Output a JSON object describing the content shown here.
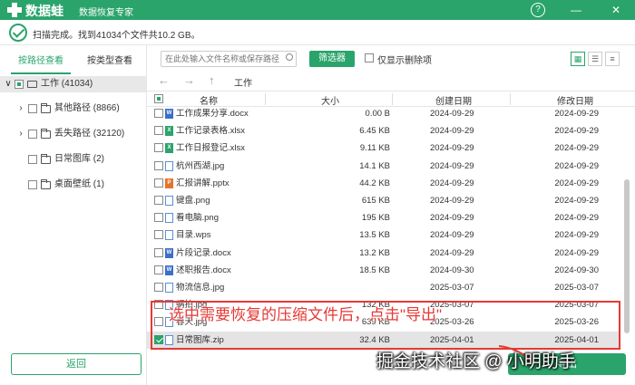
{
  "titlebar": {
    "app_name": "数据蛙",
    "app_subtitle": "数据恢复专家",
    "help_icon": "?",
    "minimize_icon": "—",
    "close_icon": "✕"
  },
  "status": {
    "text": "扫描完成。找到41034个文件共10.2 GB。"
  },
  "sidebar": {
    "tabs": [
      {
        "label": "按路径查看",
        "active": true
      },
      {
        "label": "按类型查看",
        "active": false
      }
    ],
    "tree": [
      {
        "label": "工作 (41034)",
        "expanded": true,
        "check": "partial",
        "icon": "drive-icon",
        "level": 0
      },
      {
        "label": "其他路径 (8866)",
        "expanded": false,
        "check": "none",
        "icon": "folder-icon",
        "level": 1
      },
      {
        "label": "丢失路径 (32120)",
        "expanded": false,
        "check": "none",
        "icon": "folder-icon",
        "level": 1
      },
      {
        "label": "日常图库 (2)",
        "check": "none",
        "icon": "folder-icon",
        "level": 1
      },
      {
        "label": "桌面壁纸 (1)",
        "check": "none",
        "icon": "folder-icon",
        "level": 1
      }
    ],
    "back_label": "返回"
  },
  "toolbar": {
    "search_placeholder": "在此处输入文件名称或保存路径",
    "filter_label": "筛选器",
    "only_deleted_label": "仅显示删除项"
  },
  "path": {
    "current": "工作"
  },
  "table": {
    "headers": {
      "name": "名称",
      "size": "大小",
      "created": "创建日期",
      "modified": "修改日期"
    },
    "rows": [
      {
        "name": "工作成果分享.docx",
        "size": "0.00  B",
        "created": "2024-09-29",
        "modified": "2024-09-29",
        "type": "docx",
        "checked": false
      },
      {
        "name": "工作记录表格.xlsx",
        "size": "6.45 KB",
        "created": "2024-09-29",
        "modified": "2024-09-29",
        "type": "xlsx",
        "checked": false
      },
      {
        "name": "工作日报登记.xlsx",
        "size": "9.11 KB",
        "created": "2024-09-29",
        "modified": "2024-09-29",
        "type": "xlsx",
        "checked": false
      },
      {
        "name": "杭州西湖.jpg",
        "size": "14.1 KB",
        "created": "2024-09-29",
        "modified": "2024-09-29",
        "type": "jpg",
        "checked": false
      },
      {
        "name": "汇报讲解.pptx",
        "size": "44.2 KB",
        "created": "2024-09-29",
        "modified": "2024-09-29",
        "type": "pptx",
        "checked": false
      },
      {
        "name": "键盘.png",
        "size": "615 KB",
        "created": "2024-09-29",
        "modified": "2024-09-29",
        "type": "png",
        "checked": false
      },
      {
        "name": "看电脑.png",
        "size": "195 KB",
        "created": "2024-09-29",
        "modified": "2024-09-29",
        "type": "png",
        "checked": false
      },
      {
        "name": "目录.wps",
        "size": "13.5 KB",
        "created": "2024-09-29",
        "modified": "2024-09-29",
        "type": "wps",
        "checked": false
      },
      {
        "name": "片段记录.docx",
        "size": "13.2 KB",
        "created": "2024-09-29",
        "modified": "2024-09-29",
        "type": "docx",
        "checked": false
      },
      {
        "name": "述职报告.docx",
        "size": "18.5 KB",
        "created": "2024-09-30",
        "modified": "2024-09-30",
        "type": "docx",
        "checked": false
      },
      {
        "name": "物流信息.jpg",
        "size": "",
        "created": "2025-03-07",
        "modified": "2025-03-07",
        "type": "jpg",
        "checked": false
      },
      {
        "name": "蜗拍.jpg",
        "size": "132 KB",
        "created": "2025-03-07",
        "modified": "2025-03-07",
        "type": "jpg",
        "checked": false
      },
      {
        "name": "春天.jpg",
        "size": "639 KB",
        "created": "2025-03-26",
        "modified": "2025-03-26",
        "type": "jpg",
        "checked": false
      },
      {
        "name": "日常图库.zip",
        "size": "32.4 KB",
        "created": "2025-04-01",
        "modified": "2025-04-01",
        "type": "zip",
        "checked": true
      }
    ]
  },
  "export_label": "导出",
  "annotation": "选中需要恢复的压缩文件后，点击\"导出\"",
  "watermark": "掘金技术社区 @ 小明助手",
  "colors": {
    "accent": "#2aa46b",
    "annotation": "#e53935"
  }
}
